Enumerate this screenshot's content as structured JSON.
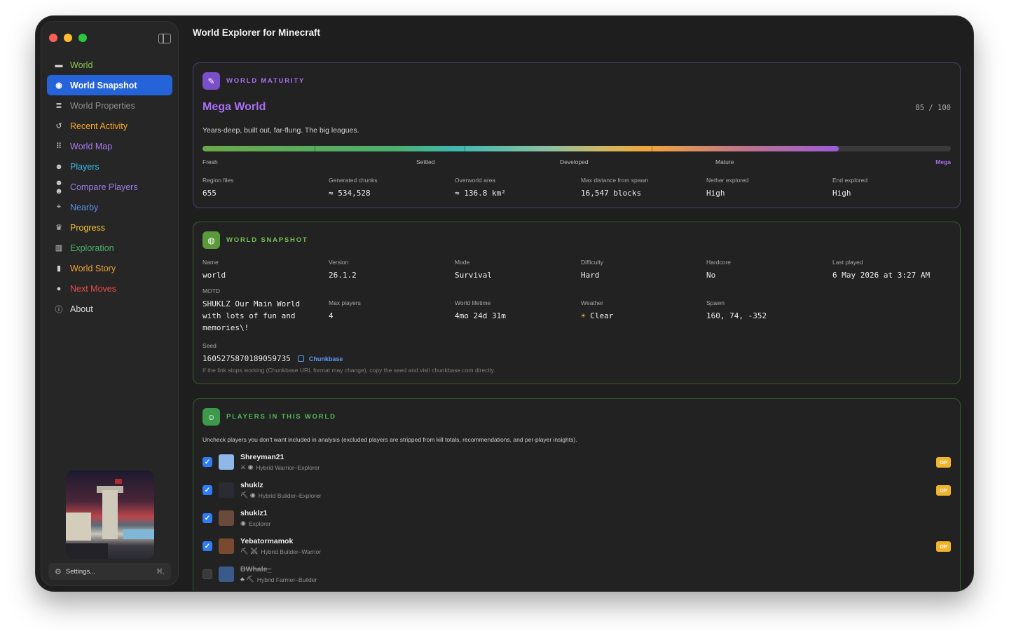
{
  "window": {
    "title": "World Explorer for Minecraft"
  },
  "sidebar": {
    "items": [
      {
        "label": "World",
        "icon": "folder-icon",
        "color": "#8bc34a",
        "active": false
      },
      {
        "label": "World Snapshot",
        "icon": "globe-icon",
        "color": "#ffffff",
        "active": true
      },
      {
        "label": "World Properties",
        "icon": "list-icon",
        "color": "#8d8d8d",
        "active": false
      },
      {
        "label": "Recent Activity",
        "icon": "history-icon",
        "color": "#f5a623",
        "active": false
      },
      {
        "label": "World Map",
        "icon": "grid-icon",
        "color": "#a97af2",
        "active": false
      },
      {
        "label": "Players",
        "icon": "people-icon",
        "color": "#35b8e0",
        "active": false
      },
      {
        "label": "Compare Players",
        "icon": "compare-icon",
        "color": "#9a7ce6",
        "active": false
      },
      {
        "label": "Nearby",
        "icon": "nearby-icon",
        "color": "#5a8de8",
        "active": false
      },
      {
        "label": "Progress",
        "icon": "trophy-icon",
        "color": "#f5c033",
        "active": false
      },
      {
        "label": "Exploration",
        "icon": "map-icon",
        "color": "#4caf6a",
        "active": false
      },
      {
        "label": "World Story",
        "icon": "book-icon",
        "color": "#f0a030",
        "active": false
      },
      {
        "label": "Next Moves",
        "icon": "lightbulb-icon",
        "color": "#e84b4b",
        "active": false
      },
      {
        "label": "About",
        "icon": "info-icon",
        "color": "#dcdcdc",
        "active": false
      }
    ],
    "settings_label": "Settings...",
    "settings_shortcut": "⌘,"
  },
  "maturity": {
    "section_title": "WORLD MATURITY",
    "accent": "#a86ef0",
    "level_name": "Mega World",
    "score": "85 / 100",
    "score_value": 85,
    "description": "Years-deep, built out, far-flung. The big leagues.",
    "stages": [
      "Fresh",
      "Settled",
      "Developed",
      "Mature",
      "Mega"
    ],
    "stats": [
      {
        "label": "Region files",
        "value": "655"
      },
      {
        "label": "Generated chunks",
        "value": "≈ 534,528"
      },
      {
        "label": "Overworld area",
        "value": "≈ 136.8 km²"
      },
      {
        "label": "Max distance from spawn",
        "value": "16,547 blocks"
      },
      {
        "label": "Nether explored",
        "value": "High"
      },
      {
        "label": "End explored",
        "value": "High"
      }
    ]
  },
  "snapshot": {
    "section_title": "WORLD SNAPSHOT",
    "accent": "#7bbf4a",
    "fields": {
      "name": {
        "label": "Name",
        "value": "world"
      },
      "version": {
        "label": "Version",
        "value": "26.1.2"
      },
      "mode": {
        "label": "Mode",
        "value": "Survival"
      },
      "difficulty": {
        "label": "Difficulty",
        "value": "Hard"
      },
      "hardcore": {
        "label": "Hardcore",
        "value": "No"
      },
      "last_played": {
        "label": "Last played",
        "value": "6 May 2026 at 3:27 AM"
      },
      "motd": {
        "label": "MOTD",
        "value": "SHUKLZ Our Main World with lots of fun and memories\\!"
      },
      "max_players": {
        "label": "Max players",
        "value": "4"
      },
      "lifetime": {
        "label": "World lifetime",
        "value": "4mo 24d 31m"
      },
      "weather": {
        "label": "Weather",
        "value": "Clear",
        "icon": "sun-icon"
      },
      "spawn": {
        "label": "Spawn",
        "value": "160, 74, -352"
      }
    },
    "seed_label": "Seed",
    "seed": "1605275870189059735",
    "chunkbase_label": "Chunkbase",
    "seed_note": "If the link stops working (Chunkbase URL format may change), copy the seed and visit chunkbase.com directly."
  },
  "players": {
    "section_title": "PLAYERS IN THIS WORLD",
    "accent": "#4cb85a",
    "description": "Uncheck players you don't want included in analysis (excluded players are stripped from kill totals, recommendations, and per-player insights).",
    "list": [
      {
        "name": "Shreyman21",
        "role": "Hybrid Warrior–Explorer",
        "role_icons": "⚔ ◉",
        "checked": true,
        "op": true,
        "op_label": "OP",
        "avatar_color": "#8fb7e8"
      },
      {
        "name": "shuklz",
        "role": "Hybrid Builder–Explorer",
        "role_icons": "⛏ ◉",
        "checked": true,
        "op": true,
        "op_label": "OP",
        "avatar_color": "#2b2b33"
      },
      {
        "name": "shuklz1",
        "role": "Explorer",
        "role_icons": "◉",
        "checked": true,
        "op": false,
        "op_label": "",
        "avatar_color": "#6a4a3a"
      },
      {
        "name": "Yebatormamok",
        "role": "Hybrid Builder–Warrior",
        "role_icons": "⛏ ⚔",
        "checked": true,
        "op": true,
        "op_label": "OP",
        "avatar_color": "#7a4a2e"
      },
      {
        "name": "BWhale_",
        "role": "Hybrid Farmer–Builder",
        "role_icons": "♣ ⛏",
        "checked": false,
        "op": false,
        "op_label": "",
        "avatar_color": "#3a5a8a"
      }
    ]
  }
}
